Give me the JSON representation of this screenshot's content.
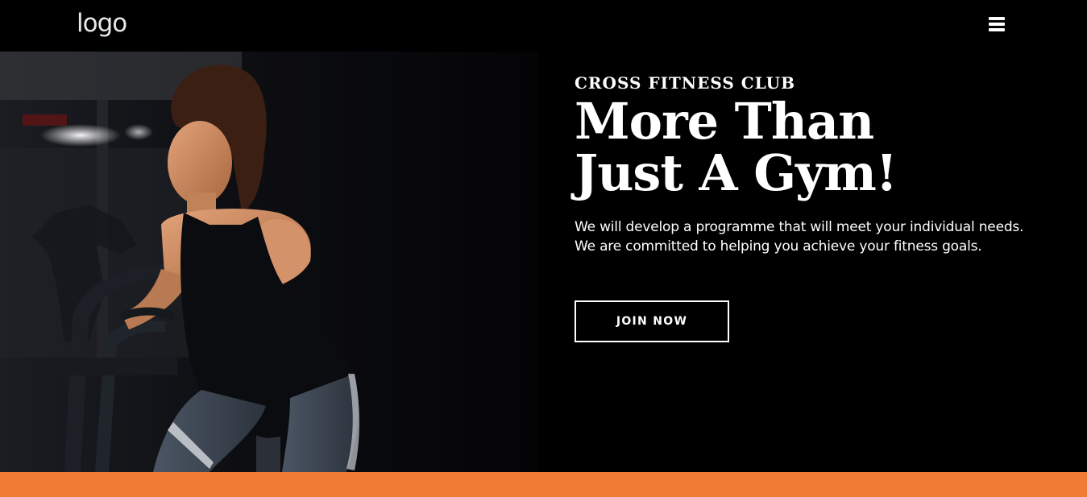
{
  "header": {
    "logo_text": "logo",
    "menu_icon": "hamburger-menu-icon"
  },
  "hero": {
    "kicker": "CROSS FITNESS CLUB",
    "headline_line1": "More Than",
    "headline_line2": "Just A Gym!",
    "description_line1": "We will develop a programme that will meet your individual needs.",
    "description_line2": "We are committed to helping you achieve your fitness goals.",
    "cta_label": "JOIN NOW",
    "image_subject": "woman-on-exercise-bike-photo"
  },
  "colors": {
    "background": "#000000",
    "text": "#ffffff",
    "accent": "#f07b34"
  }
}
